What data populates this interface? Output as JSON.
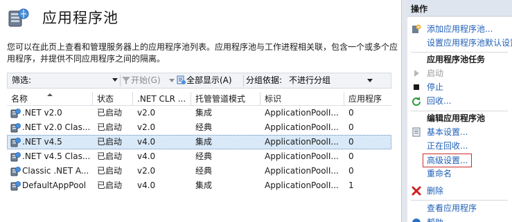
{
  "header": {
    "title": "应用程序池",
    "description": "您可以在此页上查看和管理服务器上的应用程序池列表。应用程序池与工作进程相关联，包含一个或多个应用程序，并提供不同应用程序之间的隔离。"
  },
  "filter_bar": {
    "filter_label": "筛选:",
    "start_label": "开始(G)",
    "show_all_label": "全部显示(A)",
    "group_by_label": "分组依据:",
    "group_by_value": "不进行分组"
  },
  "grid": {
    "columns": [
      "名称",
      "状态",
      ".NET CLR ...",
      "托管管道模式",
      "标识",
      "应用程序"
    ],
    "rows": [
      {
        "name": ".NET v2.0",
        "status": "已启动",
        "clr": "v2.0",
        "pipeline": "集成",
        "identity": "ApplicationPoolI...",
        "apps": "0"
      },
      {
        "name": ".NET v2.0 Clas...",
        "status": "已启动",
        "clr": "v2.0",
        "pipeline": "经典",
        "identity": "ApplicationPoolI...",
        "apps": "0"
      },
      {
        "name": ".NET v4.5",
        "status": "已启动",
        "clr": "v4.0",
        "pipeline": "集成",
        "identity": "ApplicationPoolI...",
        "apps": "0"
      },
      {
        "name": ".NET v4.5 Clas...",
        "status": "已启动",
        "clr": "v4.0",
        "pipeline": "经典",
        "identity": "ApplicationPoolI...",
        "apps": "0"
      },
      {
        "name": "Classic .NET A...",
        "status": "已启动",
        "clr": "v2.0",
        "pipeline": "经典",
        "identity": "ApplicationPoolI...",
        "apps": "0"
      },
      {
        "name": "DefaultAppPool",
        "status": "已启动",
        "clr": "v4.0",
        "pipeline": "集成",
        "identity": "ApplicationPoolI...",
        "apps": "1"
      }
    ],
    "selected_row": 2
  },
  "actions": {
    "title": "操作",
    "add_pool": "添加应用程序池...",
    "set_defaults": "设置应用程序池默认设置...",
    "tasks_section": "应用程序池任务",
    "start": "启动",
    "stop": "停止",
    "recycle": "回收...",
    "edit_section": "编辑应用程序池",
    "basic_settings": "基本设置...",
    "recycling": "正在回收...",
    "advanced_settings": "高级设置...",
    "rename": "重命名",
    "delete": "删除",
    "view_apps": "查看应用程序",
    "help": "帮助"
  },
  "colors": {
    "link": "#1f5fb7",
    "selection": "#d9e9f8",
    "highlight_box": "#cc2a2a",
    "panel_header": "#dfe5ee"
  },
  "icons": [
    "app-pool-icon",
    "filter-funnel-icon",
    "show-all-icon",
    "app-pool-row-icon",
    "add-pool-icon",
    "start-icon",
    "stop-icon",
    "recycle-icon",
    "basic-settings-icon",
    "delete-icon",
    "help-icon"
  ]
}
